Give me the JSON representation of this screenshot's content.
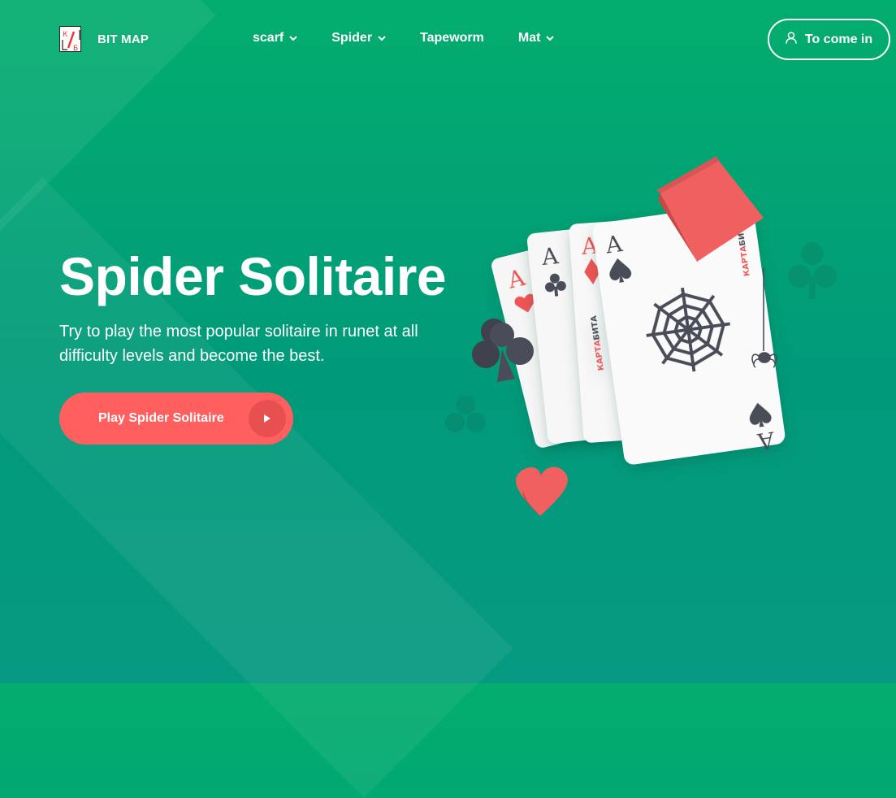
{
  "brand": {
    "name": "BIT MAP",
    "logo_letters": [
      "К",
      "Б"
    ]
  },
  "nav": {
    "items": [
      {
        "label": "scarf",
        "has_dropdown": true
      },
      {
        "label": "Spider",
        "has_dropdown": true
      },
      {
        "label": "Tapeworm",
        "has_dropdown": false
      },
      {
        "label": "Mat",
        "has_dropdown": true
      }
    ],
    "login_label": "To come in"
  },
  "hero": {
    "title": "Spider Solitaire",
    "description": "Try to play the most popular solitaire in runet at all difficulty levels and become the best.",
    "cta_label": "Play Spider Solitaire"
  },
  "cards": {
    "rank": "A",
    "brand_red": "КАРТА",
    "brand_dark": "БИТА"
  },
  "colors": {
    "bg_top": "#03ad6e",
    "bg_bottom": "#079a82",
    "accent": "#ff5f5f",
    "suit_dark": "#4a4d59",
    "suit_red": "#f05454"
  }
}
